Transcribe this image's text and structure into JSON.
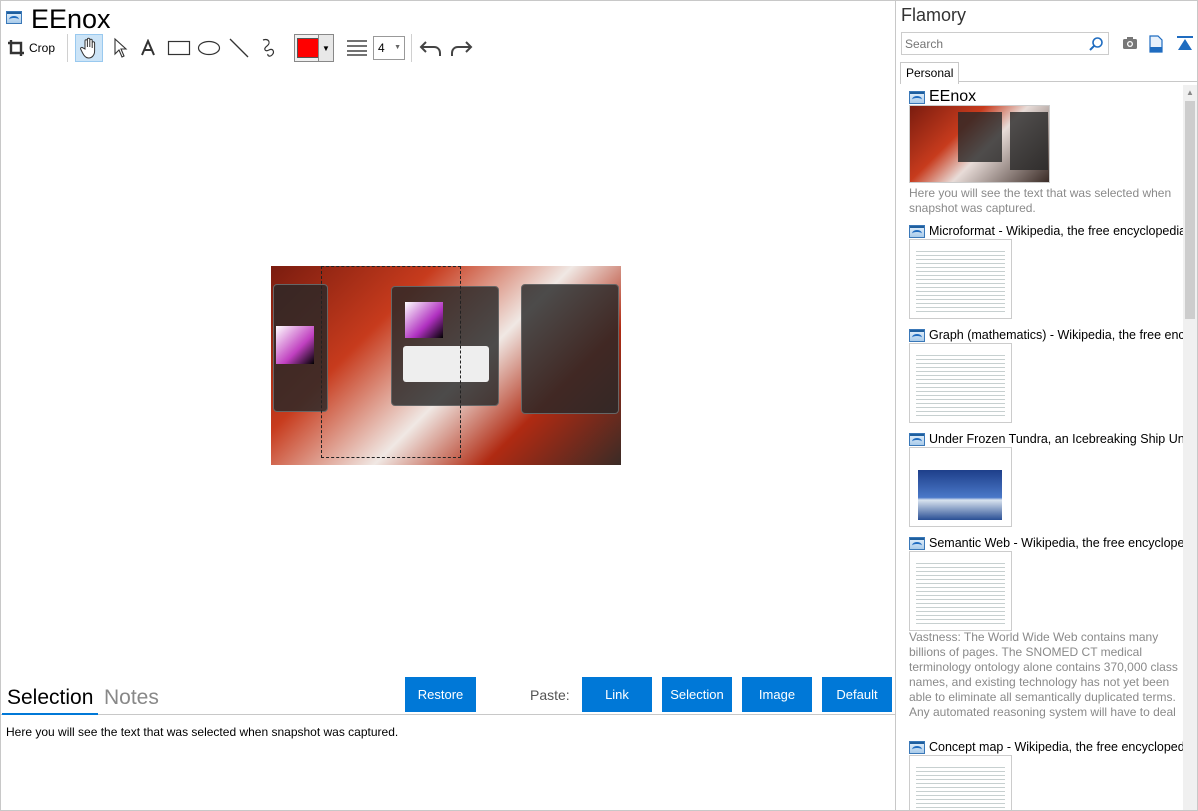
{
  "document": {
    "title": "EEnox"
  },
  "toolbar": {
    "crop_label": "Crop",
    "line_width": "4",
    "stroke_color": "#ff0000"
  },
  "bottom": {
    "tabs": [
      "Selection",
      "Notes"
    ],
    "restore_label": "Restore",
    "paste_label": "Paste:",
    "paste_buttons": [
      "Link",
      "Selection",
      "Image",
      "Default"
    ],
    "selected_text": "Here you will see the text that was selected when snapshot was captured."
  },
  "sidebar": {
    "app_title": "Flamory",
    "search_placeholder": "Search",
    "tab": "Personal",
    "items": [
      {
        "title": "EEnox",
        "desc": "Here you will see the text that was selected when snapshot was captured."
      },
      {
        "title": "Microformat - Wikipedia, the free encyclopedia"
      },
      {
        "title": "Graph (mathematics) - Wikipedia, the free encyclopedia"
      },
      {
        "title": "Under Frozen Tundra, an Icebreaking Ship Uncovers"
      },
      {
        "title": "Semantic Web - Wikipedia, the free encyclopedia",
        "desc": "Vastness: The World Wide Web contains many billions of pages. The SNOMED CT medical terminology ontology alone contains 370,000 class names, and existing technology has not yet been able to eliminate all semantically duplicated terms. Any automated reasoning system will have to deal with truly huge inputs."
      },
      {
        "title": "Concept map - Wikipedia, the free encyclopedia"
      }
    ]
  },
  "colors": {
    "accent": "#0078d7",
    "selected_tool": "#cce4f7"
  }
}
